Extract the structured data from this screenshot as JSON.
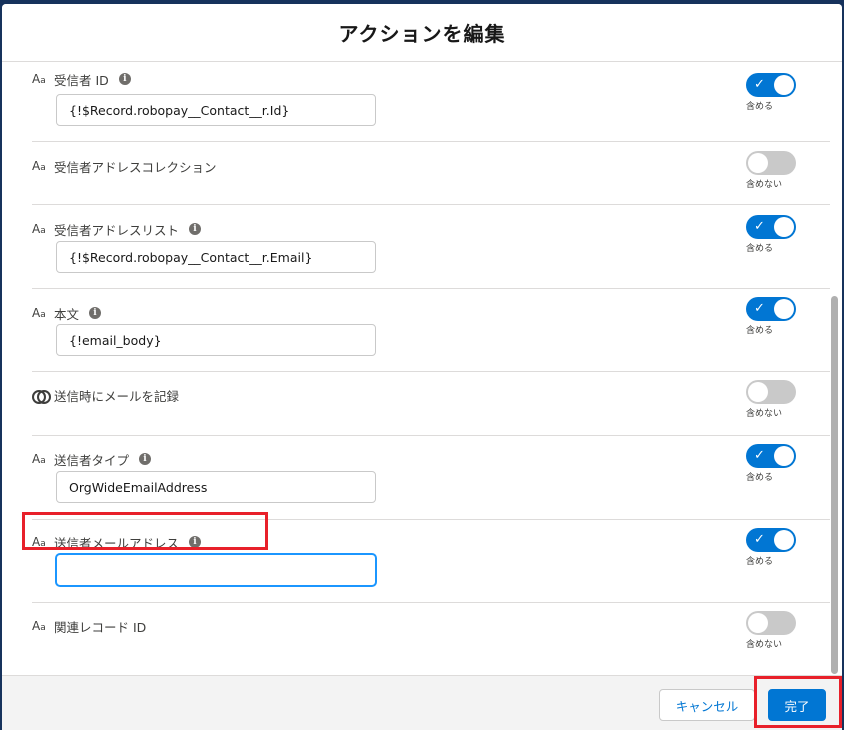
{
  "modal": {
    "title": "アクションを編集"
  },
  "fields": [
    {
      "icon": "text-type-icon",
      "label": "受信者 ID",
      "info": true,
      "value": "{!$Record.robopay__Contact__r.Id}",
      "toggle_on": true,
      "toggle_label": "含める"
    },
    {
      "icon": "text-type-icon",
      "label": "受信者アドレスコレクション",
      "info": false,
      "value": null,
      "toggle_on": false,
      "toggle_label": "含めない"
    },
    {
      "icon": "text-type-icon",
      "label": "受信者アドレスリスト",
      "info": true,
      "value": "{!$Record.robopay__Contact__r.Email}",
      "toggle_on": true,
      "toggle_label": "含める"
    },
    {
      "icon": "text-type-icon",
      "label": "本文",
      "info": true,
      "value": "{!email_body}",
      "toggle_on": true,
      "toggle_label": "含める"
    },
    {
      "icon": "boolean-type-icon",
      "label": "送信時にメールを記録",
      "info": false,
      "value": null,
      "toggle_on": false,
      "toggle_label": "含めない"
    },
    {
      "icon": "text-type-icon",
      "label": "送信者タイプ",
      "info": true,
      "value": "OrgWideEmailAddress",
      "toggle_on": true,
      "toggle_label": "含める"
    },
    {
      "icon": "text-type-icon",
      "label": "送信者メールアドレス",
      "info": true,
      "value": "",
      "toggle_on": true,
      "toggle_label": "含める"
    },
    {
      "icon": "text-type-icon",
      "label": "関連レコード ID",
      "info": false,
      "value": null,
      "toggle_on": false,
      "toggle_label": "含めない"
    }
  ],
  "footer": {
    "cancel_label": "キャンセル",
    "done_label": "完了"
  },
  "colors": {
    "brand": "#0176d3",
    "highlight": "#e8202a",
    "toggle_off": "#c9c9c9"
  }
}
